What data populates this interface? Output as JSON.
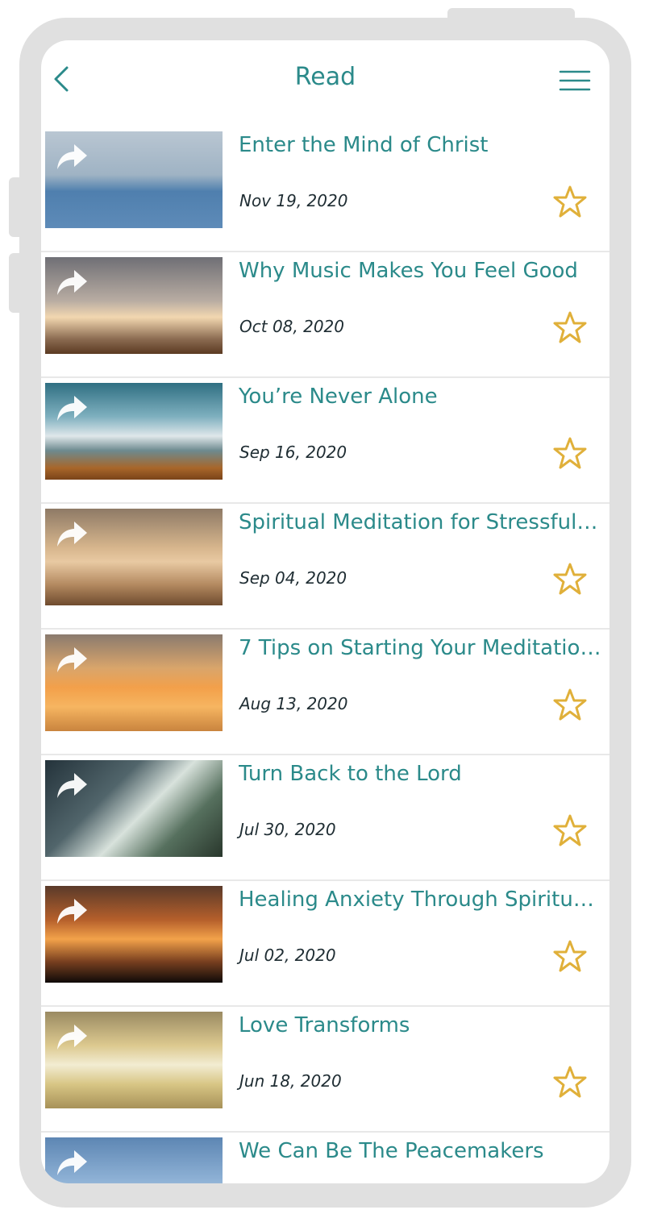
{
  "header": {
    "title": "Read",
    "back_icon": "chevron-left-icon",
    "menu_icon": "hamburger-menu-icon"
  },
  "colors": {
    "accent": "#2b8a8a",
    "star": "#e0b03a",
    "date": "#1f2d33"
  },
  "articles": [
    {
      "title": "Enter the Mind of Christ",
      "date": "Nov 19, 2020"
    },
    {
      "title": "Why Music Makes You Feel Good",
      "date": "Oct 08, 2020"
    },
    {
      "title": "You’re Never Alone",
      "date": "Sep 16, 2020"
    },
    {
      "title": "Spiritual Meditation for Stressful …",
      "date": "Sep 04, 2020"
    },
    {
      "title": "7 Tips on Starting Your Meditatio…",
      "date": "Aug 13, 2020"
    },
    {
      "title": "Turn Back to the Lord",
      "date": "Jul 30, 2020"
    },
    {
      "title": "Healing Anxiety Through Spiritual…",
      "date": "Jul 02, 2020"
    },
    {
      "title": "Love Transforms",
      "date": "Jun 18, 2020"
    },
    {
      "title": "We Can Be The Peacemakers",
      "date": ""
    }
  ]
}
